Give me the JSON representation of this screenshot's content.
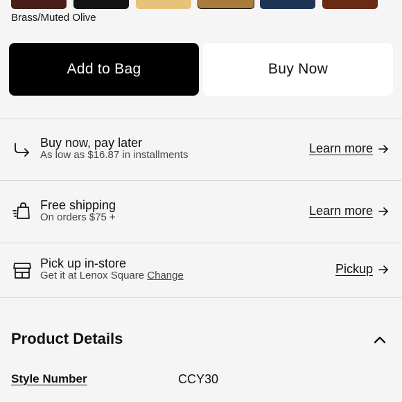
{
  "swatches": [
    {
      "name": "swatch-1",
      "color": "#4a1f1a"
    },
    {
      "name": "swatch-2",
      "color": "#141414"
    },
    {
      "name": "swatch-3",
      "color": "#e6c37a"
    },
    {
      "name": "swatch-4",
      "color": "#a87c3a",
      "selected": true
    },
    {
      "name": "swatch-5",
      "color": "#1f3558"
    },
    {
      "name": "swatch-6",
      "color": "#6b2a14"
    }
  ],
  "selected_color": "Brass/Muted Olive",
  "actions": {
    "add_to_bag": "Add to Bag",
    "buy_now": "Buy Now"
  },
  "rows": {
    "installments": {
      "title": "Buy now, pay later",
      "subtitle": "As low as $16.87 in installments",
      "link": "Learn more",
      "icon": "redirect-arrow-icon"
    },
    "shipping": {
      "title": "Free shipping",
      "subtitle": "On orders $75 +",
      "link": "Learn more",
      "icon": "shopping-bag-icon"
    },
    "pickup": {
      "title": "Pick up in-store",
      "subtitle_prefix": "Get it at Lenox Square",
      "change": "Change",
      "link": "Pickup",
      "icon": "store-icon"
    }
  },
  "product_details": {
    "title": "Product Details",
    "expanded": true,
    "style_number_label": "Style Number",
    "style_number_value": "CCY30"
  }
}
